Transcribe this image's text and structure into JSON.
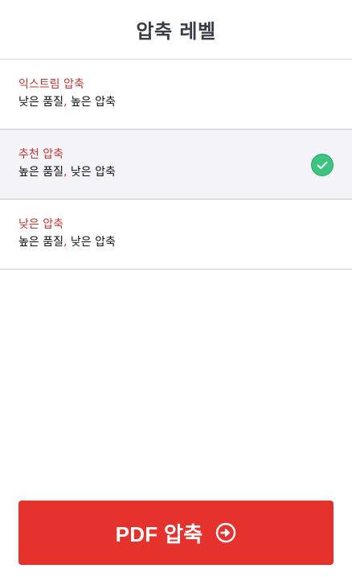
{
  "header": {
    "title": "압축 레벨"
  },
  "options": [
    {
      "title": "익스트림 압축",
      "desc_a": "낮은 품질",
      "desc_sep": ",",
      "desc_b": " 높은 압축",
      "selected": false
    },
    {
      "title": "추천 압축",
      "desc_a": "높은 품질",
      "desc_sep": ",",
      "desc_b": " 낮은 압축",
      "selected": true
    },
    {
      "title": "낮은 압축",
      "desc_a": "높은 품질",
      "desc_sep": ",",
      "desc_b": " 낮은 압축",
      "selected": false
    }
  ],
  "action": {
    "label": "PDF 압축",
    "icon": "arrow-right-circle-icon"
  },
  "colors": {
    "accent": "#e5322d",
    "option_title": "#c7352f",
    "selected_bg": "#f4f4f8",
    "check": "#3cc481",
    "header_text": "#383e45"
  }
}
